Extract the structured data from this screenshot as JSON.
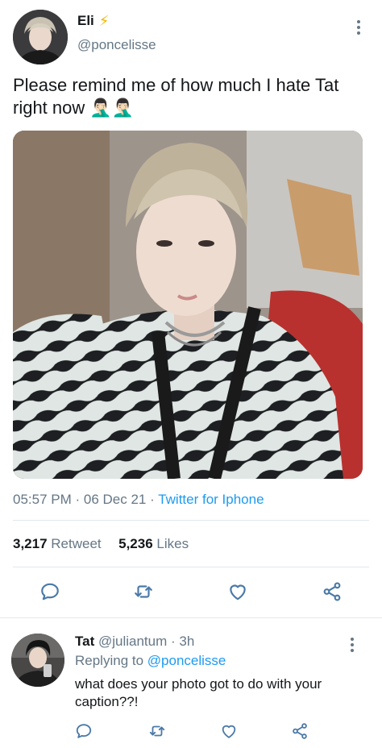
{
  "author": {
    "name": "Eli",
    "badge": "⚡",
    "handle": "@poncelisse"
  },
  "tweet": {
    "text": "Please remind me of how much I hate Tat right now 🤦🏻‍♂️🤦🏻‍♂️"
  },
  "meta": {
    "time": "05:57 PM",
    "sep1": " · ",
    "date": "06 Dec 21",
    "sep2": " · ",
    "source": "Twitter for Iphone"
  },
  "stats": {
    "retweets_count": "3,217",
    "retweets_label": "Retweet",
    "likes_count": "5,236",
    "likes_label": "Likes"
  },
  "reply": {
    "name": "Tat",
    "handle": "@juliantum",
    "age": "· 3h",
    "replying_prefix": "Replying to",
    "replying_handle": "@poncelisse",
    "text": "what does your photo got to do with your caption??!"
  },
  "colors": {
    "accent": "#1d9bf0",
    "muted": "#657786",
    "divider": "#e1e8ed",
    "icon": "#4a7aa8"
  },
  "icons": [
    "more-vertical-icon",
    "reply-icon",
    "retweet-icon",
    "like-icon",
    "share-icon",
    "lightning-icon"
  ]
}
